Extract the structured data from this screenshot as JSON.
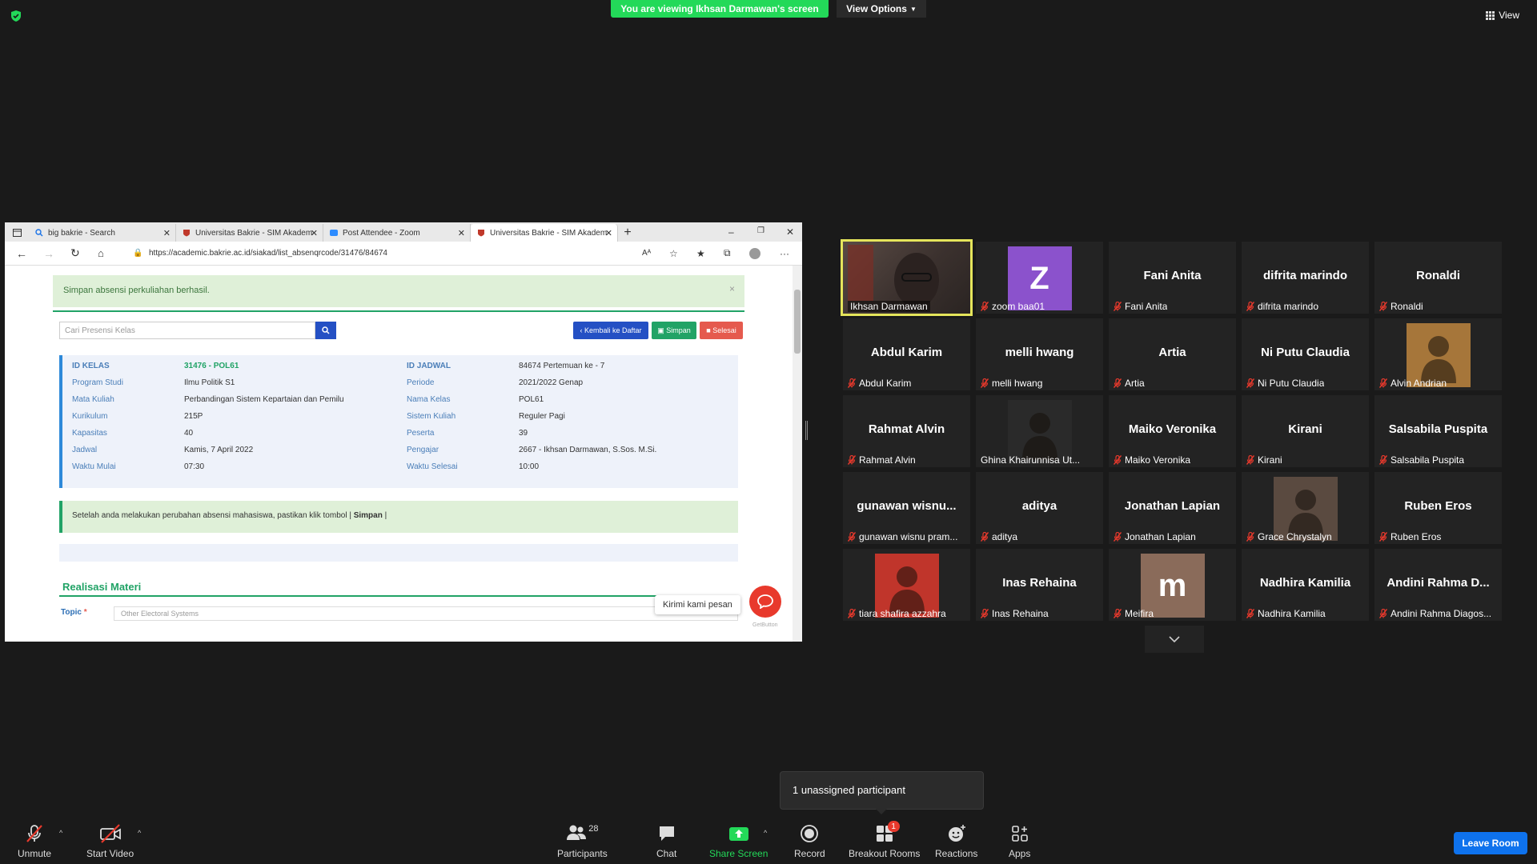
{
  "banner": {
    "viewing_text": "You are viewing Ikhsan Darmawan's screen",
    "view_options_label": "View Options",
    "view_label": "View"
  },
  "browser": {
    "tabs": [
      {
        "label": "big bakrie - Search"
      },
      {
        "label": "Universitas Bakrie - SIM Akadem"
      },
      {
        "label": "Post Attendee - Zoom"
      },
      {
        "label": "Universitas Bakrie - SIM Akadem"
      }
    ],
    "url": "https://academic.bakrie.ac.id/siakad/list_absenqrcode/31476/84674"
  },
  "siakad": {
    "alert_text": "Simpan absensi perkuliahan berhasil.",
    "search_placeholder": "Cari Presensi Kelas",
    "btn_back": "Kembali ke Daftar",
    "btn_save": "Simpan",
    "btn_done": "Selesai",
    "left_info": [
      {
        "k": "ID KELAS",
        "v": "31476 - POL61"
      },
      {
        "k": "Program Studi",
        "v": "Ilmu Politik S1"
      },
      {
        "k": "Mata Kuliah",
        "v": "Perbandingan Sistem Kepartaian dan Pemilu"
      },
      {
        "k": "Kurikulum",
        "v": "215P"
      },
      {
        "k": "Kapasitas",
        "v": "40"
      },
      {
        "k": "Jadwal",
        "v": "Kamis, 7 April 2022"
      },
      {
        "k": "Waktu Mulai",
        "v": "07:30"
      }
    ],
    "right_info": [
      {
        "k": "ID JADWAL",
        "v": "84674 Pertemuan ke - 7"
      },
      {
        "k": "Periode",
        "v": "2021/2022 Genap"
      },
      {
        "k": "Nama Kelas",
        "v": "POL61"
      },
      {
        "k": "Sistem Kuliah",
        "v": "Reguler Pagi"
      },
      {
        "k": "Peserta",
        "v": "39"
      },
      {
        "k": "Pengajar",
        "v": "2667 - Ikhsan Darmawan, S.Sos. M.Si."
      },
      {
        "k": "Waktu Selesai",
        "v": "10:00"
      }
    ],
    "note_text": "Setelah anda melakukan perubahan absensi mahasiswa, pastikan klik tombol | ",
    "note_bold": "Simpan",
    "note_end": " |",
    "section_title": "Realisasi Materi",
    "topic_label": "Topic",
    "topic_value": "Other Electoral Systems",
    "chat_tip": "Kirimi kami pesan",
    "getbutton": "GetButton"
  },
  "participants": [
    {
      "big": "",
      "label": "Ikhsan Darmawan",
      "kind": "video",
      "muted": false,
      "active": true
    },
    {
      "big": "Z",
      "label": "zoom baa01",
      "kind": "letter",
      "color": "#8b52cc",
      "muted": true
    },
    {
      "big": "Fani Anita",
      "label": "Fani Anita",
      "kind": "name",
      "muted": true
    },
    {
      "big": "difrita marindo",
      "label": "difrita marindo",
      "kind": "name",
      "muted": true
    },
    {
      "big": "Ronaldi",
      "label": "Ronaldi",
      "kind": "name",
      "muted": true
    },
    {
      "big": "Abdul Karim",
      "label": "Abdul Karim",
      "kind": "name",
      "muted": true
    },
    {
      "big": "melli hwang",
      "label": "melli hwang",
      "kind": "name",
      "muted": true
    },
    {
      "big": "Artia",
      "label": "Artia",
      "kind": "name",
      "muted": true
    },
    {
      "big": "Ni Putu Claudia",
      "label": "Ni Putu Claudia",
      "kind": "name",
      "muted": true
    },
    {
      "big": "",
      "label": "Alvin Andrian",
      "kind": "photo",
      "color": "#a6763a",
      "muted": true
    },
    {
      "big": "Rahmat Alvin",
      "label": "Rahmat Alvin",
      "kind": "name",
      "muted": true
    },
    {
      "big": "",
      "label": "Ghina Khairunnisa Ut...",
      "kind": "photo",
      "color": "#2a2a2a",
      "muted": false
    },
    {
      "big": "Maiko Veronika",
      "label": "Maiko Veronika",
      "kind": "name",
      "muted": true
    },
    {
      "big": "Kirani",
      "label": "Kirani",
      "kind": "name",
      "muted": true
    },
    {
      "big": "Salsabila Puspita",
      "label": "Salsabila Puspita",
      "kind": "name",
      "muted": true
    },
    {
      "big": "gunawan  wisnu...",
      "label": "gunawan wisnu pram...",
      "kind": "name",
      "muted": true
    },
    {
      "big": "aditya",
      "label": "aditya",
      "kind": "name",
      "muted": true
    },
    {
      "big": "Jonathan Lapian",
      "label": "Jonathan Lapian",
      "kind": "name",
      "muted": true
    },
    {
      "big": "",
      "label": "Grace Chrystalyn",
      "kind": "photo",
      "color": "#5a4a40",
      "muted": true
    },
    {
      "big": "Ruben Eros",
      "label": "Ruben Eros",
      "kind": "name",
      "muted": true
    },
    {
      "big": "",
      "label": "tiara shafira azzahra",
      "kind": "photo",
      "color": "#c0352b",
      "muted": true
    },
    {
      "big": "Inas Rehaina",
      "label": "Inas Rehaina",
      "kind": "name",
      "muted": true
    },
    {
      "big": "m",
      "label": "Meifira",
      "kind": "letter",
      "color": "#8a6b5a",
      "muted": true
    },
    {
      "big": "Nadhira Kamilia",
      "label": "Nadhira Kamilia",
      "kind": "name",
      "muted": true
    },
    {
      "big": "Andini  Rahma  D...",
      "label": "Andini Rahma Diagos...",
      "kind": "name",
      "muted": true
    }
  ],
  "unassigned_text": "1 unassigned participant",
  "toolbar": {
    "unmute": "Unmute",
    "start_video": "Start Video",
    "participants": "Participants",
    "participants_count": "28",
    "chat": "Chat",
    "share_screen": "Share Screen",
    "record": "Record",
    "breakout_rooms": "Breakout Rooms",
    "breakout_badge": "1",
    "reactions": "Reactions",
    "apps": "Apps",
    "leave_room": "Leave Room"
  },
  "colors": {
    "share_green": "#23d959",
    "leave_blue": "#0e72ed",
    "mute_red": "#e8392c",
    "active_border": "#e5e55b"
  }
}
